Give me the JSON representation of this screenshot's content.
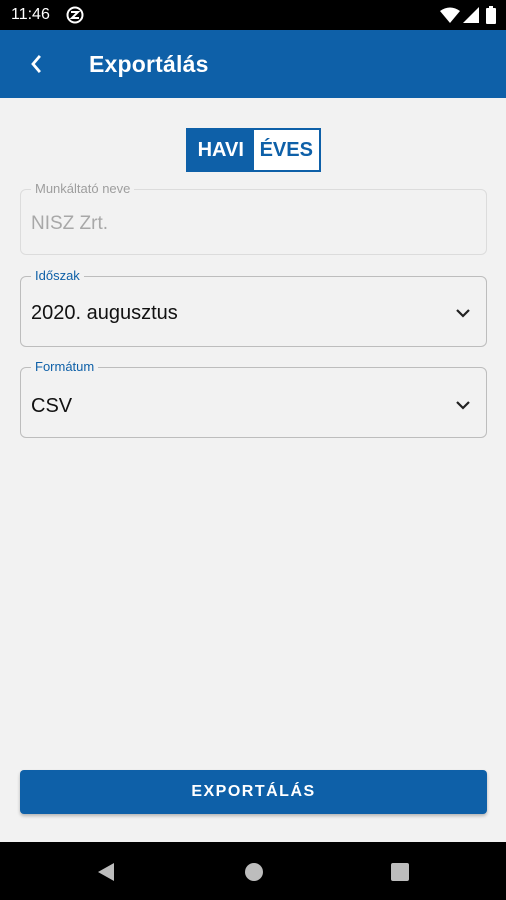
{
  "status_bar": {
    "time": "11:46",
    "icons": [
      "app-notification-icon",
      "wifi-icon",
      "signal-icon",
      "battery-icon"
    ]
  },
  "app_bar": {
    "title": "Exportálás",
    "back_icon": "chevron-left-icon",
    "color": "#0e60a8"
  },
  "period_toggle": {
    "options": [
      {
        "label": "HAVI",
        "selected": true
      },
      {
        "label": "ÉVES",
        "selected": false
      }
    ]
  },
  "form": {
    "employer": {
      "label": "Munkáltató neve",
      "value": "NISZ Zrt.",
      "disabled": true
    },
    "period": {
      "label": "Időszak",
      "value": "2020. augusztus",
      "label_color": "#0e60a8"
    },
    "format": {
      "label": "Formátum",
      "value": "CSV",
      "label_color": "#0e60a8"
    }
  },
  "export_button": {
    "label": "EXPORTÁLÁS"
  },
  "nav_bar": {
    "buttons": [
      "back-triangle-icon",
      "home-circle-icon",
      "recents-square-icon"
    ]
  }
}
